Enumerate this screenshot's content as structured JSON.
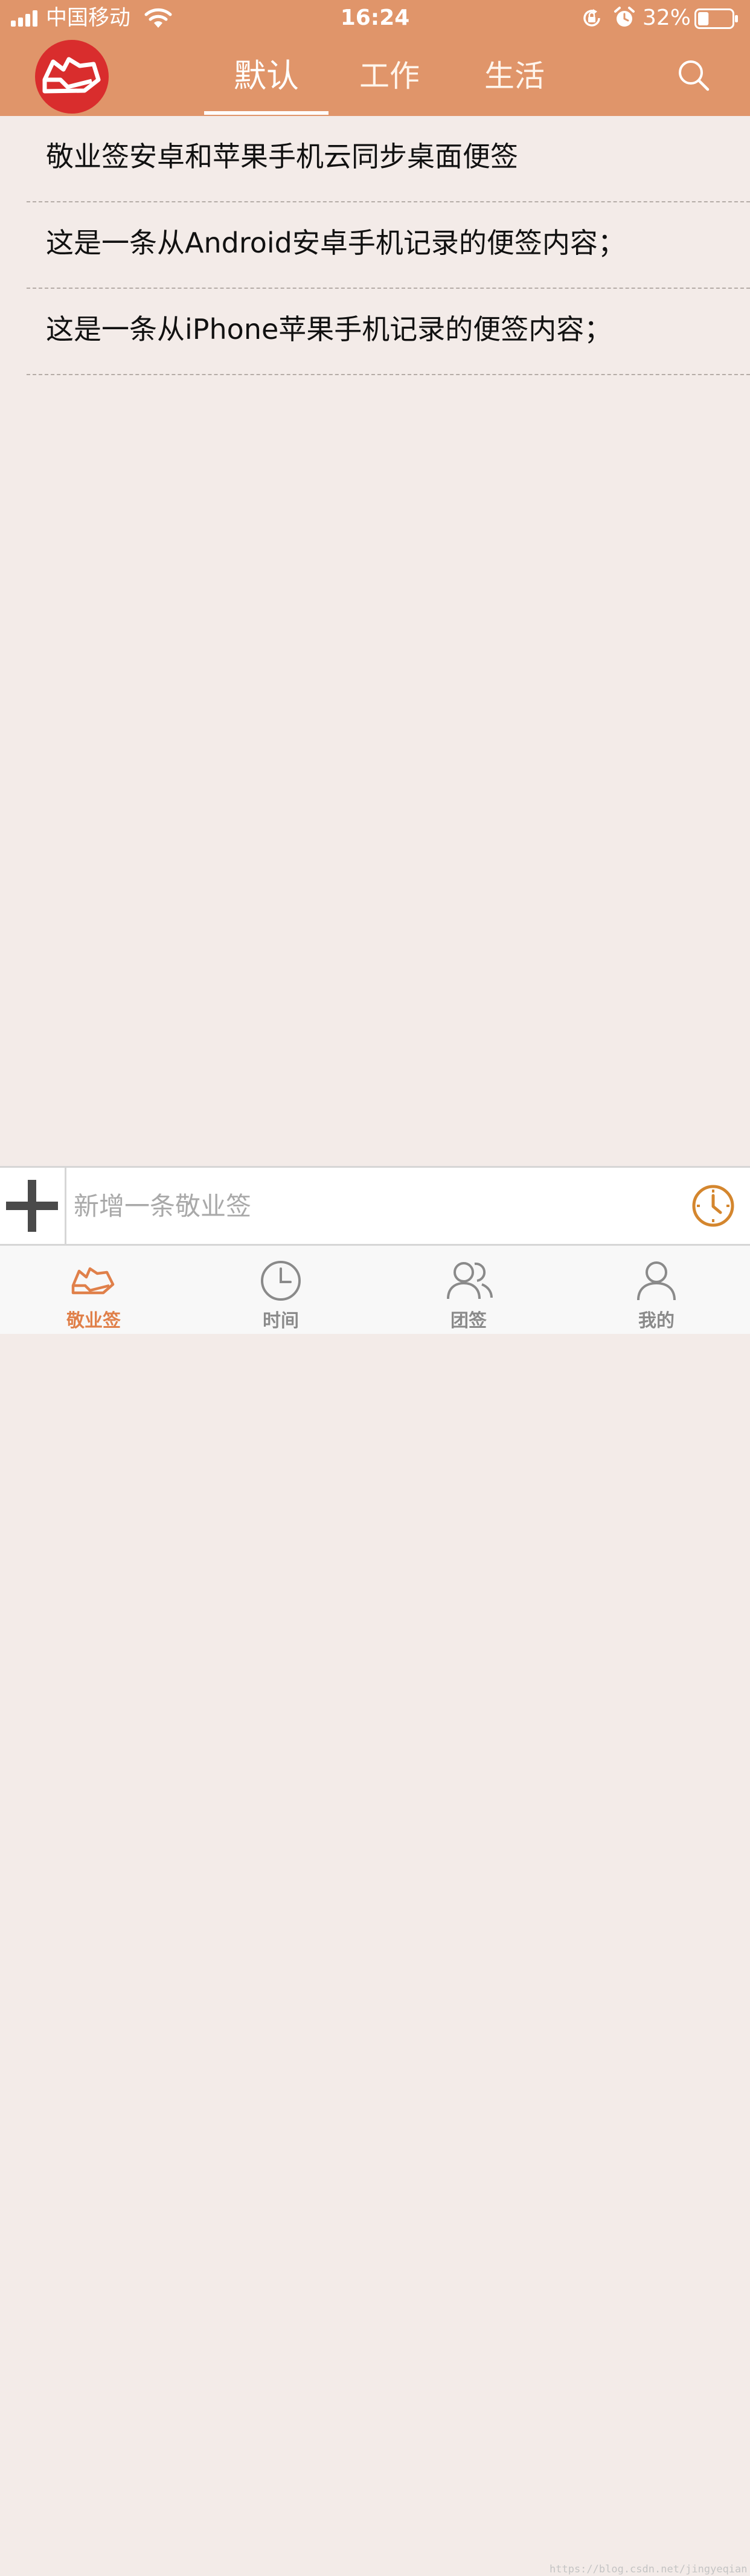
{
  "status_bar": {
    "carrier": "中国移动",
    "time": "16:24",
    "battery_percent": "32%",
    "battery_level": 0.32,
    "icons": [
      "signal-icon",
      "wifi-icon",
      "rotation-lock-icon",
      "alarm-icon",
      "battery-icon"
    ]
  },
  "nav": {
    "logo_icon": "jingye-logo-icon",
    "tabs": [
      {
        "label": "默认",
        "active": true
      },
      {
        "label": "工作",
        "active": false
      },
      {
        "label": "生活",
        "active": false
      }
    ],
    "search_icon": "search-icon"
  },
  "notes": [
    {
      "text": "敬业签安卓和苹果手机云同步桌面便签"
    },
    {
      "text": "这是一条从Android安卓手机记录的便签内容；"
    },
    {
      "text": "这是一条从iPhone苹果手机记录的便签内容；"
    }
  ],
  "input_bar": {
    "add_icon": "plus-icon",
    "placeholder": "新增一条敬业签",
    "reminder_icon": "clock-icon"
  },
  "bottom_tabs": [
    {
      "label": "敬业签",
      "icon": "note-icon",
      "active": true
    },
    {
      "label": "时间",
      "icon": "clock-icon",
      "active": false
    },
    {
      "label": "团签",
      "icon": "group-icon",
      "active": false
    },
    {
      "label": "我的",
      "icon": "user-icon",
      "active": false
    }
  ],
  "watermark": "https://blog.csdn.net/jingyeqian",
  "colors": {
    "header": "#e0956a",
    "accent": "#e0804a",
    "logo": "#d92d2d",
    "background": "#f3ebe8",
    "reminder": "#d4862e"
  }
}
